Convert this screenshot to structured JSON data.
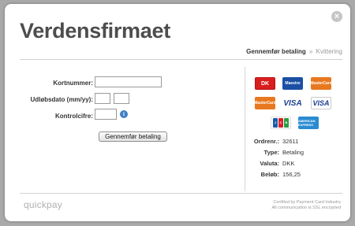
{
  "brand": "Verdensfirmaet",
  "close_label": "×",
  "steps": {
    "current": "Gennemfør betaling",
    "separator": "»",
    "next": "Kvittering"
  },
  "form": {
    "card_number_label": "Kortnummer:",
    "expiry_label": "Udløbsdato (mm/yy):",
    "cvc_label": "Kontrolcifre:",
    "info_symbol": "i",
    "submit_label": "Gennemfør betaling"
  },
  "cards": [
    "Dankort",
    "Maestro",
    "MasterCard",
    "MasterCard",
    "VISA",
    "VISA Electron",
    "JCB",
    "American Express"
  ],
  "card_texts": {
    "dk": "DK",
    "maestro": "Maestro",
    "mc": "MasterCard",
    "visa": "VISA",
    "jcb": [
      "J",
      "C",
      "B"
    ],
    "amex": "AMERICAN EXPRESS"
  },
  "order": {
    "rows": [
      {
        "key": "Ordrenr.:",
        "value": "32611"
      },
      {
        "key": "Type:",
        "value": "Betaling"
      },
      {
        "key": "Valuta:",
        "value": "DKK"
      },
      {
        "key": "Beløb:",
        "value": "156,25"
      }
    ]
  },
  "footer": {
    "logo": "quickpay",
    "note_line1": "Certified by Payment Card Industry",
    "note_line2": "All communication is SSL encrypted"
  }
}
